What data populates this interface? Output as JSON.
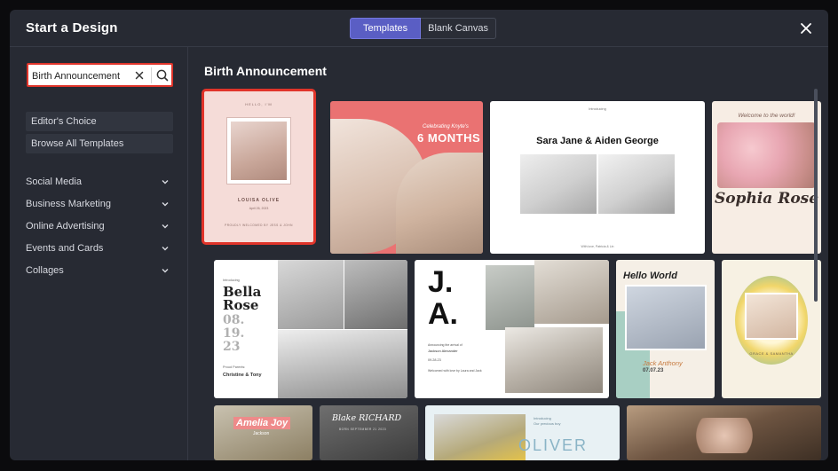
{
  "header": {
    "title": "Start a Design",
    "tabs": [
      {
        "label": "Templates",
        "active": true
      },
      {
        "label": "Blank Canvas",
        "active": false
      }
    ],
    "close_icon": "close-icon"
  },
  "sidebar": {
    "search": {
      "value": "Birth Announcement",
      "clear_icon": "close-icon",
      "search_icon": "search-icon"
    },
    "quick_links": [
      "Editor's Choice",
      "Browse All Templates"
    ],
    "categories": [
      "Social Media",
      "Business Marketing",
      "Online Advertising",
      "Events and Cards",
      "Collages"
    ]
  },
  "main": {
    "title": "Birth Announcement",
    "cards": {
      "c1": {
        "top": "HELLO, I'M",
        "name": "LOUISA OLIVE",
        "detail": "April 26, 2023",
        "footer": "PROUDLY WELCOMED BY JESS & JOHN"
      },
      "c2": {
        "script": "Celebrating Knyte's",
        "big": "6 MONTHS"
      },
      "c3": {
        "top": "Introducing",
        "names": "Sara Jane & Aiden George",
        "footer": "With love, Patricia & Lin"
      },
      "c4": {
        "script": "Welcome to the world!",
        "name": "Sophia Rose"
      },
      "c5": {
        "intro": "Introducing",
        "name1": "Bella",
        "name2": "Rose",
        "date1": "08.",
        "date2": "19.",
        "date3": "23",
        "parents_label": "Proud Parents:",
        "parents": "Christine & Tony"
      },
      "c6": {
        "l1": "J.",
        "l2": "A.",
        "text": "Announcing the arrival of",
        "name": "Jackson Alexander",
        "date": "09.28.23",
        "footer": "Welcomed with love by Laura and Jack"
      },
      "c7": {
        "title": "Hello World",
        "name": "Jack Anthony",
        "date": "07.07.23"
      },
      "c8": {
        "names": "GRACE & SAMANTHA"
      },
      "c9": {
        "name": "Amelia Joy",
        "sub": "Jackson"
      },
      "c10": {
        "name": "Blake RICHARD",
        "sub": "BORN SEPTEMBER 21 2023"
      },
      "c11": {
        "top": "Introducing",
        "sub": "Our precious boy",
        "name": "OLIVER"
      }
    }
  },
  "colors": {
    "accent": "#5a5ec4",
    "selection": "#e0342a",
    "panel": "#272a33"
  }
}
